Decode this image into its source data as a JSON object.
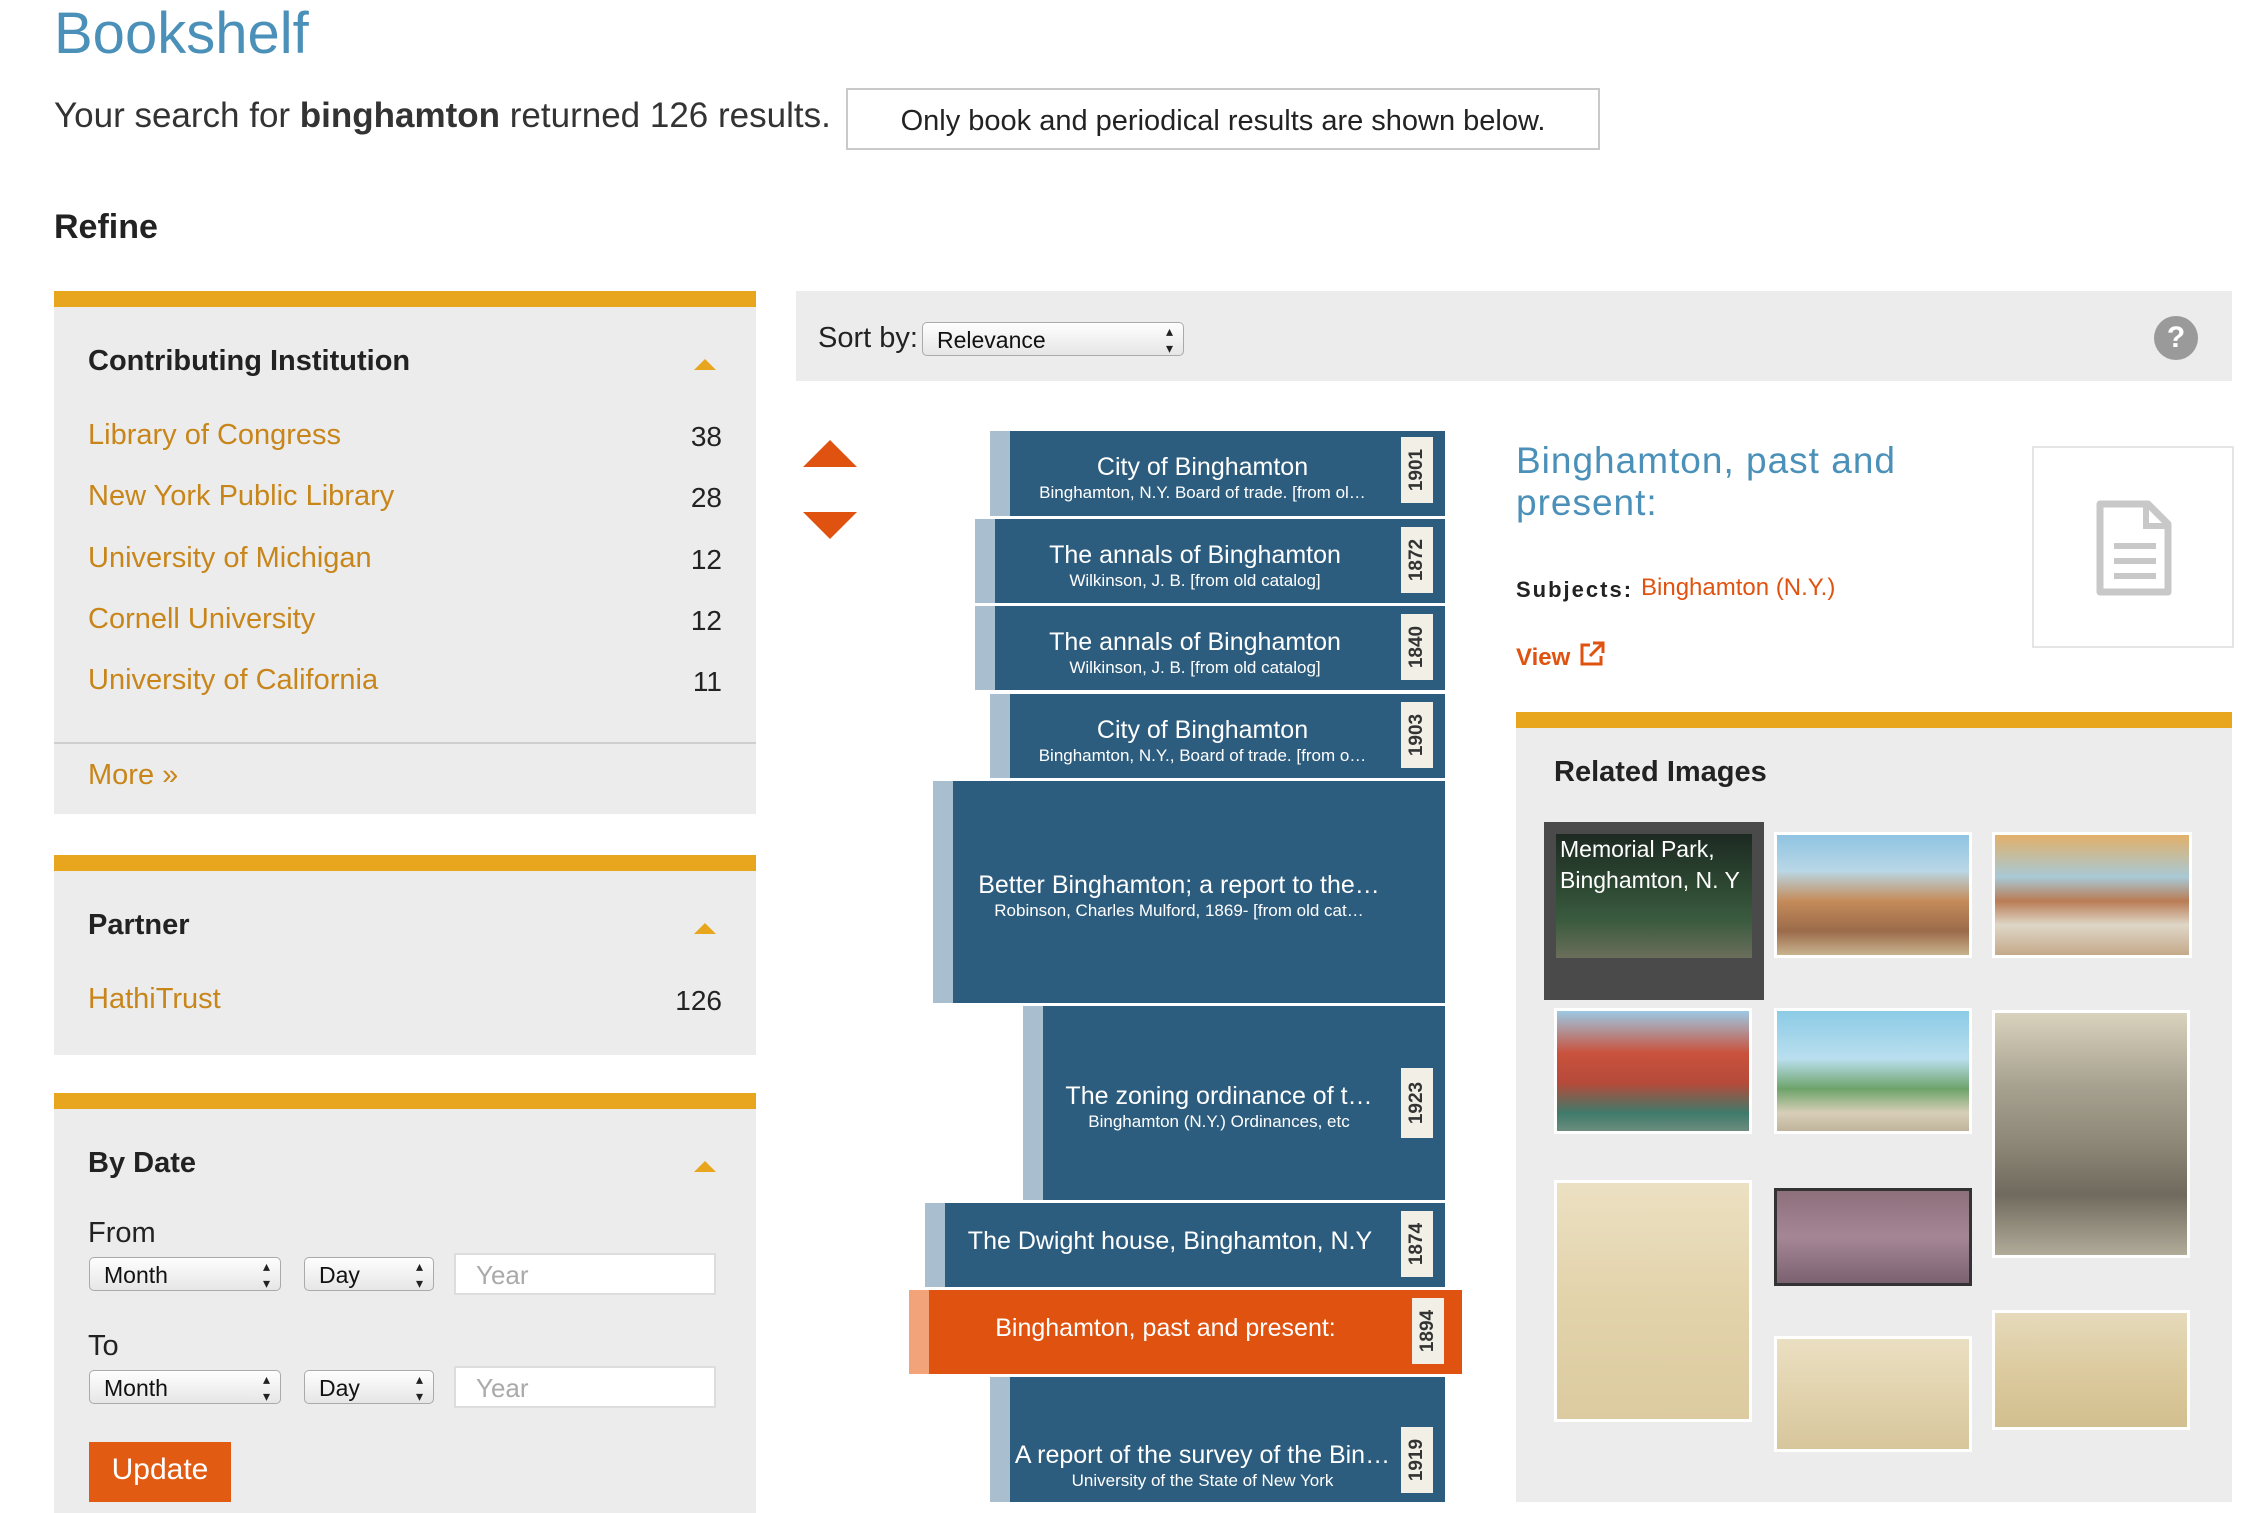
{
  "page": {
    "title": "Bookshelf",
    "search_prefix": "Your search for ",
    "search_term": "binghamton",
    "search_suffix": " returned 126 results.",
    "notice": "Only book and periodical results are shown below.",
    "refine_heading": "Refine"
  },
  "facets": {
    "institution": {
      "title": "Contributing Institution",
      "items": [
        {
          "label": "Library of Congress",
          "count": "38"
        },
        {
          "label": "New York Public Library",
          "count": "28"
        },
        {
          "label": "University of Michigan",
          "count": "12"
        },
        {
          "label": "Cornell University",
          "count": "12"
        },
        {
          "label": "University of California",
          "count": "11"
        }
      ],
      "more": "More »"
    },
    "partner": {
      "title": "Partner",
      "items": [
        {
          "label": "HathiTrust",
          "count": "126"
        }
      ]
    },
    "date": {
      "title": "By Date",
      "from_label": "From",
      "to_label": "To",
      "month_placeholder": "Month",
      "day_placeholder": "Day",
      "year_placeholder": "Year",
      "update_label": "Update"
    }
  },
  "sort": {
    "label": "Sort by:",
    "value": "Relevance",
    "help": "?"
  },
  "books": [
    {
      "title": "City of Binghamton",
      "subtitle": "Binghamton, N.Y. Board of trade. [from ol…",
      "year": "1901"
    },
    {
      "title": "The annals of Binghamton",
      "subtitle": "Wilkinson, J. B. [from old catalog]",
      "year": "1872"
    },
    {
      "title": "The annals of Binghamton",
      "subtitle": "Wilkinson, J. B. [from old catalog]",
      "year": "1840"
    },
    {
      "title": "City of Binghamton",
      "subtitle": "Binghamton, N.Y., Board of trade. [from o…",
      "year": "1903"
    },
    {
      "title": "Better Binghamton; a report to the…",
      "subtitle": "Robinson, Charles Mulford, 1869- [from old cat…",
      "year": ""
    },
    {
      "title": "The zoning ordinance of t…",
      "subtitle": "Binghamton (N.Y.) Ordinances, etc",
      "year": "1923"
    },
    {
      "title": "The Dwight house, Binghamton, N.Y",
      "subtitle": "",
      "year": "1874"
    },
    {
      "title": "Binghamton, past and present:",
      "subtitle": "",
      "year": "1894"
    },
    {
      "title": "A report of the survey of the Bin…",
      "subtitle": "University of the State of New York",
      "year": "1919"
    }
  ],
  "detail": {
    "title": "Binghamton, past and present:",
    "subjects_label": "Subjects:",
    "subjects_value": "Binghamton (N.Y.)",
    "view_label": "View"
  },
  "related": {
    "title": "Related Images",
    "first_caption": "Memorial Park, Binghamton, N. Y"
  },
  "colors": {
    "accent": "#e8a61e",
    "link": "#c8861a",
    "brand_blue": "#4a90b8",
    "book_blue": "#2d5d7e",
    "active_orange": "#e0520f"
  }
}
